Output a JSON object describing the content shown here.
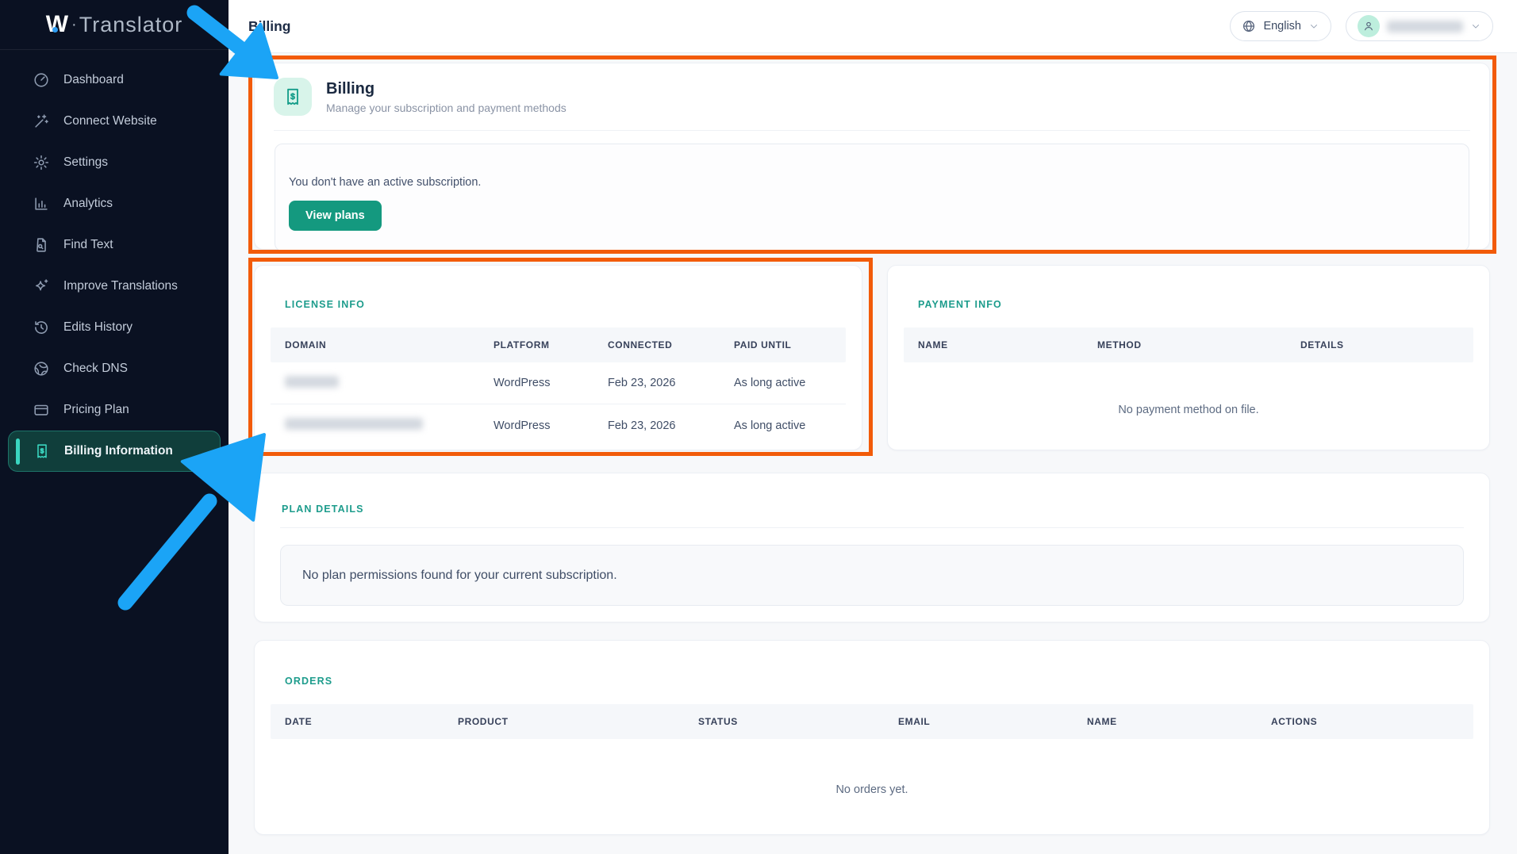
{
  "app": {
    "logo_w": "W",
    "logo_separator": "·",
    "logo_rest": "Translator"
  },
  "sidebar": {
    "items": [
      {
        "label": "Dashboard",
        "icon": "dashboard-icon",
        "active": false
      },
      {
        "label": "Connect Website",
        "icon": "magic-wand-icon",
        "active": false
      },
      {
        "label": "Settings",
        "icon": "gear-icon",
        "active": false
      },
      {
        "label": "Analytics",
        "icon": "bar-chart-icon",
        "active": false
      },
      {
        "label": "Find Text",
        "icon": "document-search-icon",
        "active": false
      },
      {
        "label": "Improve Translations",
        "icon": "sparkle-icon",
        "active": false
      },
      {
        "label": "Edits History",
        "icon": "history-clock-icon",
        "active": false
      },
      {
        "label": "Check DNS",
        "icon": "globe-icon",
        "active": false
      },
      {
        "label": "Pricing Plan",
        "icon": "credit-card-icon",
        "active": false
      },
      {
        "label": "Billing Information",
        "icon": "receipt-icon",
        "active": true
      }
    ]
  },
  "topbar": {
    "title": "Billing",
    "language": {
      "label": "English",
      "icon": "globe-icon",
      "chevron": "chevron-down-icon"
    },
    "user": {
      "name": "",
      "name_redacted": true,
      "icon": "person-icon",
      "chevron": "chevron-down-icon"
    }
  },
  "billing_header": {
    "title": "Billing",
    "subtitle": "Manage your subscription and payment methods",
    "icon": "receipt-icon"
  },
  "subscription": {
    "message": "You don't have an active subscription.",
    "button_label": "View plans"
  },
  "license": {
    "heading": "LICENSE INFO",
    "columns": [
      "DOMAIN",
      "PLATFORM",
      "CONNECTED",
      "PAID UNTIL"
    ],
    "rows": [
      {
        "domain": "",
        "domain_redacted": true,
        "platform": "WordPress",
        "connected": "Feb 23, 2026",
        "paid_until": "As long active"
      },
      {
        "domain": "",
        "domain_redacted": true,
        "platform": "WordPress",
        "connected": "Feb 23, 2026",
        "paid_until": "As long active"
      }
    ]
  },
  "payment": {
    "heading": "PAYMENT INFO",
    "columns": [
      "NAME",
      "METHOD",
      "DETAILS"
    ],
    "empty_message": "No payment method on file."
  },
  "plan": {
    "heading": "PLAN DETAILS",
    "empty_message": "No plan permissions found for your current subscription."
  },
  "orders": {
    "heading": "ORDERS",
    "columns": [
      "DATE",
      "PRODUCT",
      "STATUS",
      "EMAIL",
      "NAME",
      "ACTIONS"
    ],
    "empty_message": "No orders yet."
  },
  "annotations": {
    "highlight_color": "#f25b09",
    "arrow_color": "#1ba4f6",
    "highlighted_regions": [
      "billing-header-card",
      "license-info-section"
    ]
  },
  "colors": {
    "sidebar_bg": "#0a1122",
    "accent_teal": "#14997f",
    "active_item_teal": "#3ad6c0",
    "section_heading_teal": "#1d9c8c"
  }
}
